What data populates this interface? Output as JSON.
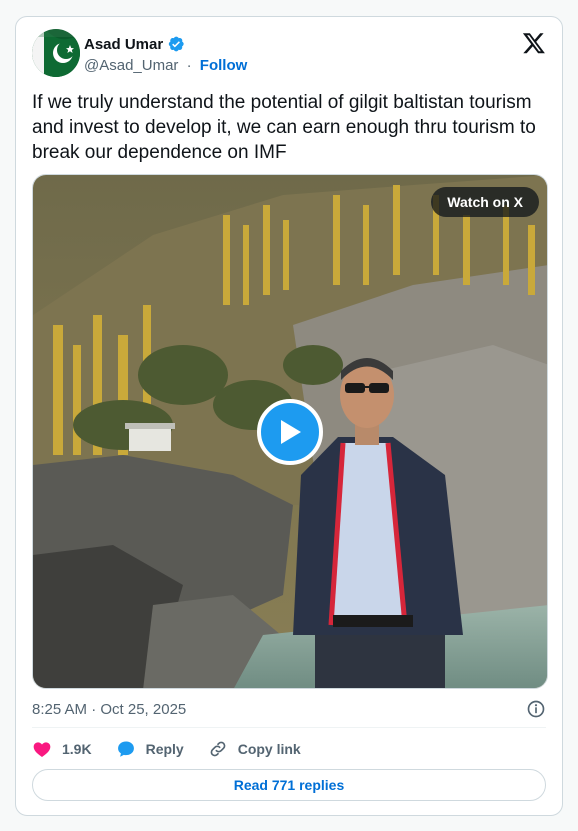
{
  "author": {
    "display_name": "Asad Umar",
    "handle": "@Asad_Umar",
    "separator": "·",
    "follow_label": "Follow"
  },
  "tweet": {
    "text": "If we truly understand the potential of gilgit baltistan tourism and invest to develop it, we can earn enough thru tourism to break our dependence on IMF",
    "timestamp": "8:25 AM · Oct 25, 2025"
  },
  "media": {
    "watch_label": "Watch on X"
  },
  "actions": {
    "likes": "1.9K",
    "reply_label": "Reply",
    "copy_link_label": "Copy link"
  },
  "read_replies_label": "Read 771 replies",
  "colors": {
    "accent": "#1d9bf0",
    "link": "#006fd6",
    "like": "#f91880"
  }
}
